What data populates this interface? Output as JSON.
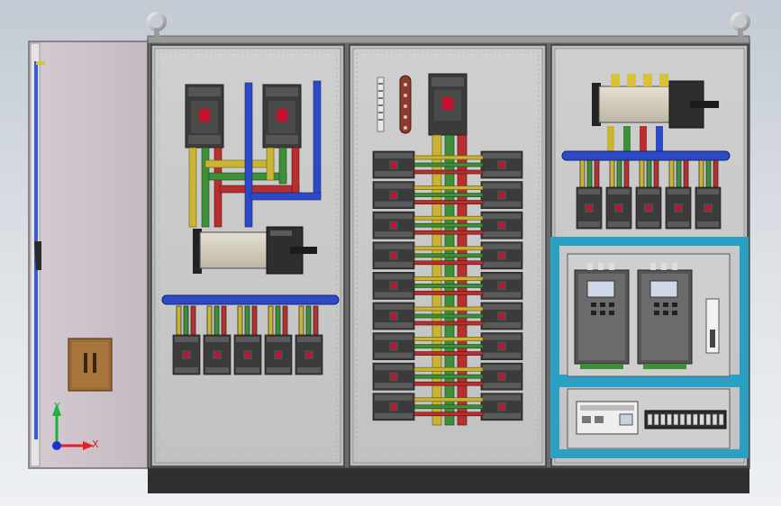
{
  "viewport": {
    "background": "#d6dbe1"
  },
  "cabinet": {
    "sections": [
      "left-door",
      "feeder-section",
      "distribution-section",
      "drive-section"
    ],
    "body_color": "#c9c9c9",
    "frame_color": "#4a4a4a",
    "door_color": "#cbbfc8",
    "plinth_color": "#2f2f2f"
  },
  "busbar_colors": {
    "phase_l1": "#c9b436",
    "phase_l2": "#3f8f3a",
    "phase_l3": "#b82f2f",
    "neutral": "#2c49c8"
  },
  "drive_panel_accent": "#2aa1c4",
  "triad": {
    "y_label": "Y",
    "x_label": "X",
    "y_color": "#1bb33c",
    "x_color": "#e0202a",
    "z_color": "#2030d0"
  }
}
